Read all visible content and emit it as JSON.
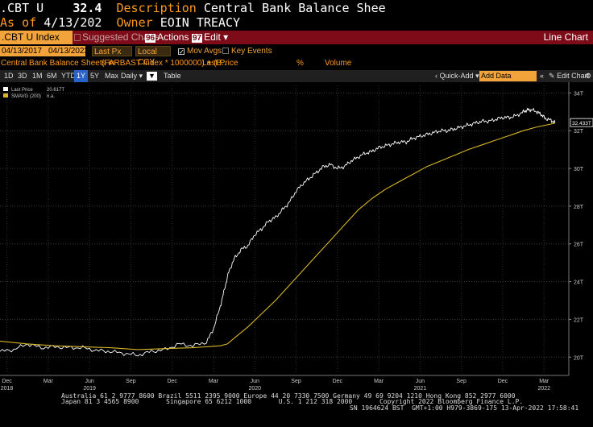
{
  "header": {
    "ticker": ".CBT U",
    "value": "32.4",
    "description_label": "Description",
    "description": "Central Bank Balance Shee",
    "asof_label": "As of",
    "asof": "4/13/202",
    "owner_label": "Owner",
    "owner": "EOIN TREACY"
  },
  "toolbar": {
    "security": ".CBT U Index",
    "suggested": "Suggested Charts",
    "actions_num": "96",
    "actions": "Actions",
    "edit_num": "97",
    "edit": "Edit",
    "chart_type": "Line Chart"
  },
  "params": {
    "start_date": "04/13/2017",
    "end_date": "04/13/2022",
    "price_field": "Last Px",
    "currency": "Local CCY",
    "mov_avgs": "Mov Avgs",
    "key_events": "Key Events"
  },
  "legend_row": {
    "title": "Central Bank Balance Sheets in",
    "formula": "(FARBAST Index * 1000000) + (B..",
    "last_price": "Last Price",
    "pct": "%",
    "volume": "Volume"
  },
  "periods": [
    "1D",
    "3D",
    "1M",
    "6M",
    "YTD",
    "1Y",
    "5Y",
    "Max"
  ],
  "selected_period": "1Y",
  "period_controls": {
    "frequency": "Daily",
    "table": "Table",
    "quick_add": "Quick-Add",
    "add_data": "Add Data",
    "edit_chart": "Edit Chart"
  },
  "chart_data": {
    "type": "line",
    "legend": [
      {
        "name": "Last Price",
        "value": "20.617T",
        "color": "#ffffff"
      },
      {
        "name": "SMAVG (200)",
        "value": "n.a.",
        "color": "#d6b628"
      }
    ],
    "last_value_label": "32.433T",
    "y_ticks": [
      "34T",
      "32T",
      "30T",
      "28T",
      "26T",
      "24T",
      "22T",
      "20T"
    ],
    "y_tick_values": [
      34,
      32,
      30,
      28,
      26,
      24,
      22,
      20
    ],
    "ylim": [
      19.2,
      34.4
    ],
    "x_ticks": [
      {
        "label": "Dec",
        "year": "2018",
        "t": 0.5
      },
      {
        "label": "Mar",
        "year": "",
        "t": 3.5
      },
      {
        "label": "Jun",
        "year": "2019",
        "t": 6.5
      },
      {
        "label": "Sep",
        "year": "",
        "t": 9.5
      },
      {
        "label": "Dec",
        "year": "",
        "t": 12.5
      },
      {
        "label": "Mar",
        "year": "",
        "t": 15.5
      },
      {
        "label": "Jun",
        "year": "2020",
        "t": 18.5
      },
      {
        "label": "Sep",
        "year": "",
        "t": 21.5
      },
      {
        "label": "Dec",
        "year": "",
        "t": 24.5
      },
      {
        "label": "Mar",
        "year": "",
        "t": 27.5
      },
      {
        "label": "Jun",
        "year": "2021",
        "t": 30.5
      },
      {
        "label": "Sep",
        "year": "",
        "t": 33.5
      },
      {
        "label": "Dec",
        "year": "",
        "t": 36.5
      },
      {
        "label": "Mar",
        "year": "2022",
        "t": 39.5
      }
    ],
    "xlim": [
      0,
      41.3
    ],
    "series": [
      {
        "name": "Last Price",
        "color": "#ffffff",
        "x": [
          0,
          1,
          2,
          3,
          4,
          5,
          6,
          7,
          8,
          9,
          10,
          11,
          12,
          13,
          14,
          15,
          15.5,
          16,
          16.3,
          16.6,
          17,
          17.5,
          18,
          18.5,
          19,
          19.5,
          20,
          20.5,
          21,
          21.5,
          22,
          22.5,
          23,
          23.5,
          24,
          24.5,
          25,
          25.5,
          26,
          26.5,
          27,
          27.5,
          28,
          28.5,
          29,
          29.5,
          30,
          30.5,
          31,
          31.5,
          32,
          32.5,
          33,
          33.5,
          34,
          34.5,
          35,
          35.5,
          36,
          36.5,
          37,
          37.5,
          38,
          38.3,
          38.6,
          39,
          39.3,
          39.6,
          40,
          40.3
        ],
        "y": [
          20.3,
          20.4,
          20.7,
          20.5,
          20.55,
          20.5,
          20.5,
          20.35,
          20.3,
          20.2,
          20.1,
          20.3,
          20.4,
          20.7,
          20.6,
          20.8,
          21.5,
          22.7,
          23.6,
          24.5,
          25.2,
          25.7,
          25.9,
          26.5,
          26.8,
          27.2,
          27.4,
          27.8,
          28.2,
          28.8,
          29.2,
          29.5,
          29.8,
          30.1,
          30.2,
          30.0,
          30.1,
          30.4,
          30.6,
          30.8,
          30.9,
          31.1,
          31.2,
          31.3,
          31.4,
          31.4,
          31.6,
          31.7,
          31.8,
          31.9,
          32.0,
          32.0,
          32.1,
          32.2,
          32.3,
          32.4,
          32.5,
          32.5,
          32.6,
          32.7,
          32.7,
          32.8,
          33.0,
          33.1,
          33.1,
          33.0,
          32.85,
          32.65,
          32.55,
          32.43
        ]
      },
      {
        "name": "SMAVG (200)",
        "color": "#d6b628",
        "x": [
          0,
          2,
          4,
          6,
          8,
          10,
          12,
          14,
          15,
          16,
          16.5,
          17,
          18,
          19,
          20,
          21,
          22,
          23,
          24,
          25,
          26,
          27,
          28,
          29,
          30,
          31,
          32,
          33,
          34,
          35,
          36,
          37,
          38,
          39,
          40,
          40.3
        ],
        "y": [
          20.85,
          20.7,
          20.6,
          20.55,
          20.5,
          20.4,
          20.45,
          20.5,
          20.55,
          20.6,
          20.7,
          21.0,
          21.6,
          22.3,
          23.0,
          23.8,
          24.6,
          25.4,
          26.2,
          27.0,
          27.8,
          28.4,
          28.9,
          29.3,
          29.7,
          30.1,
          30.4,
          30.7,
          31.0,
          31.25,
          31.5,
          31.75,
          32.0,
          32.2,
          32.35,
          32.4
        ]
      }
    ]
  },
  "footer": {
    "line1": "Australia 61 2 9777 8600 Brazil 5511 2395 9000 Europe 44 20 7330 7500 Germany 49 69 9204 1210 Hong Kong 852 2977 6000",
    "line2": "Japan 81 3 4565 8900       Singapore 65 6212 1000       U.S. 1 212 318 2000       Copyright 2022 Bloomberg Finance L.P.",
    "line3": "SN 1964624 BST  GMT+1:00 H979-3869-175 13-Apr-2022 17:58:41"
  }
}
